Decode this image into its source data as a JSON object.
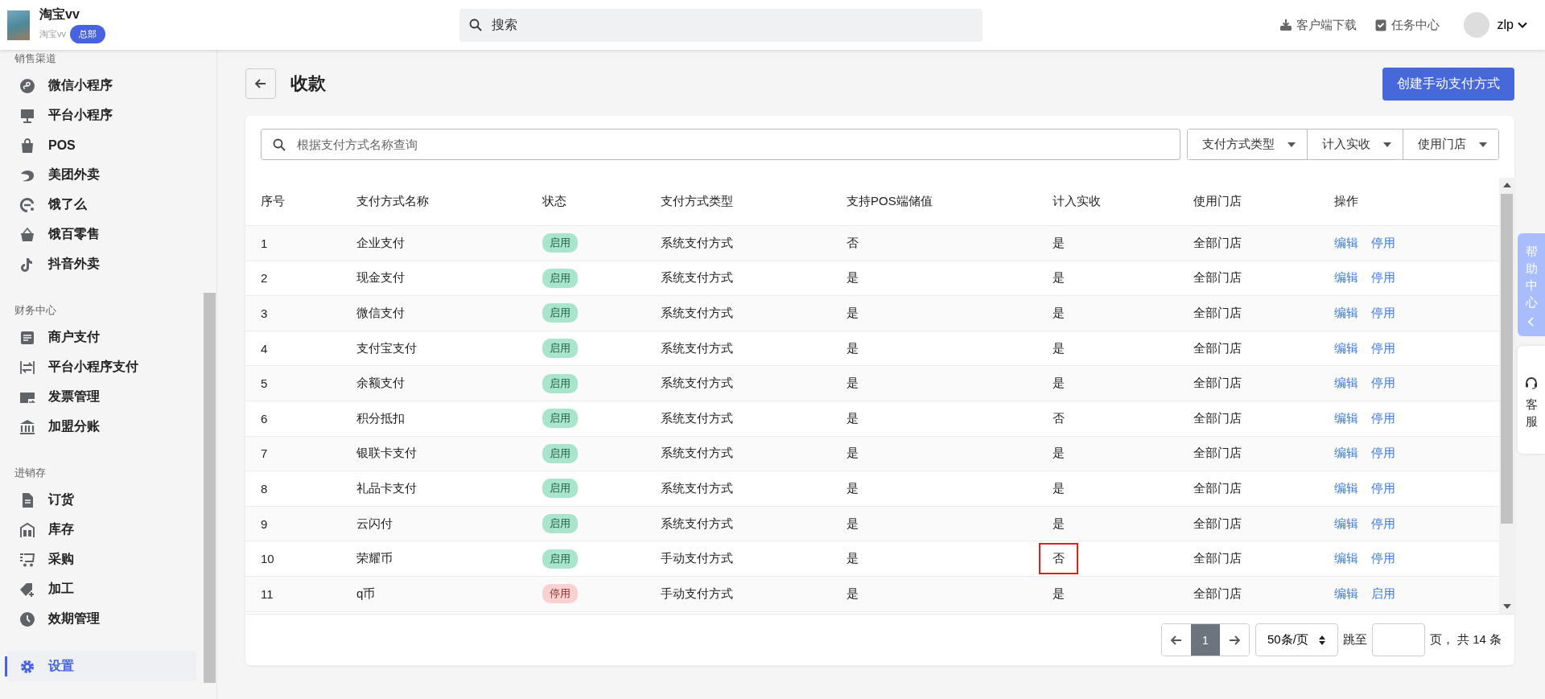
{
  "header": {
    "brand": "淘宝vv",
    "sub": "淘宝vv",
    "badge": "总部",
    "search_placeholder": "搜索",
    "links": [
      {
        "label": "客户端下载"
      },
      {
        "label": "任务中心"
      }
    ],
    "user": "zlp"
  },
  "sidebar": {
    "groups": [
      {
        "label": "销售渠道",
        "items": [
          {
            "label": "微信小程序",
            "selected": false
          },
          {
            "label": "平台小程序",
            "selected": false
          },
          {
            "label": "POS",
            "selected": false
          },
          {
            "label": "美团外卖",
            "selected": false
          },
          {
            "label": "饿了么",
            "selected": false
          },
          {
            "label": "饿百零售",
            "selected": false
          },
          {
            "label": "抖音外卖",
            "selected": false
          }
        ]
      },
      {
        "label": "财务中心",
        "items": [
          {
            "label": "商户支付",
            "selected": false
          },
          {
            "label": "平台小程序支付",
            "selected": false
          },
          {
            "label": "发票管理",
            "selected": false
          },
          {
            "label": "加盟分账",
            "selected": false
          }
        ]
      },
      {
        "label": "进销存",
        "items": [
          {
            "label": "订货",
            "selected": false
          },
          {
            "label": "库存",
            "selected": false
          },
          {
            "label": "采购",
            "selected": false
          },
          {
            "label": "加工",
            "selected": false
          },
          {
            "label": "效期管理",
            "selected": false
          }
        ]
      },
      {
        "items": [
          {
            "label": "设置",
            "selected": true
          }
        ]
      }
    ]
  },
  "page": {
    "title": "收款",
    "create_button": "创建手动支付方式"
  },
  "filters": {
    "search_placeholder": "根据支付方式名称查询",
    "dropdowns": [
      "支付方式类型",
      "计入实收",
      "使用门店"
    ]
  },
  "table": {
    "columns": [
      "序号",
      "支付方式名称",
      "状态",
      "支付方式类型",
      "支持POS端储值",
      "计入实收",
      "使用门店",
      "操作"
    ],
    "rows": [
      {
        "no": "1",
        "name": "企业支付",
        "status": "启用",
        "enabled": true,
        "type": "系统支付方式",
        "pos": "否",
        "counted": "是",
        "counted_marked": false,
        "stores": "全部门店",
        "actions": [
          "编辑",
          "停用"
        ]
      },
      {
        "no": "2",
        "name": "现金支付",
        "status": "启用",
        "enabled": true,
        "type": "系统支付方式",
        "pos": "是",
        "counted": "是",
        "counted_marked": false,
        "stores": "全部门店",
        "actions": [
          "编辑",
          "停用"
        ]
      },
      {
        "no": "3",
        "name": "微信支付",
        "status": "启用",
        "enabled": true,
        "type": "系统支付方式",
        "pos": "是",
        "counted": "是",
        "counted_marked": false,
        "stores": "全部门店",
        "actions": [
          "编辑",
          "停用"
        ]
      },
      {
        "no": "4",
        "name": "支付宝支付",
        "status": "启用",
        "enabled": true,
        "type": "系统支付方式",
        "pos": "是",
        "counted": "是",
        "counted_marked": false,
        "stores": "全部门店",
        "actions": [
          "编辑",
          "停用"
        ]
      },
      {
        "no": "5",
        "name": "余额支付",
        "status": "启用",
        "enabled": true,
        "type": "系统支付方式",
        "pos": "是",
        "counted": "是",
        "counted_marked": false,
        "stores": "全部门店",
        "actions": [
          "编辑",
          "停用"
        ]
      },
      {
        "no": "6",
        "name": "积分抵扣",
        "status": "启用",
        "enabled": true,
        "type": "系统支付方式",
        "pos": "是",
        "counted": "否",
        "counted_marked": false,
        "stores": "全部门店",
        "actions": [
          "编辑",
          "停用"
        ]
      },
      {
        "no": "7",
        "name": "银联卡支付",
        "status": "启用",
        "enabled": true,
        "type": "系统支付方式",
        "pos": "是",
        "counted": "是",
        "counted_marked": false,
        "stores": "全部门店",
        "actions": [
          "编辑",
          "停用"
        ]
      },
      {
        "no": "8",
        "name": "礼品卡支付",
        "status": "启用",
        "enabled": true,
        "type": "系统支付方式",
        "pos": "是",
        "counted": "是",
        "counted_marked": false,
        "stores": "全部门店",
        "actions": [
          "编辑",
          "停用"
        ]
      },
      {
        "no": "9",
        "name": "云闪付",
        "status": "启用",
        "enabled": true,
        "type": "系统支付方式",
        "pos": "是",
        "counted": "是",
        "counted_marked": false,
        "stores": "全部门店",
        "actions": [
          "编辑",
          "停用"
        ]
      },
      {
        "no": "10",
        "name": "荣耀币",
        "status": "启用",
        "enabled": true,
        "type": "手动支付方式",
        "pos": "是",
        "counted": "否",
        "counted_marked": true,
        "stores": "全部门店",
        "actions": [
          "编辑",
          "停用"
        ]
      },
      {
        "no": "11",
        "name": "q币",
        "status": "停用",
        "enabled": false,
        "type": "手动支付方式",
        "pos": "是",
        "counted": "是",
        "counted_marked": false,
        "stores": "全部门店",
        "actions": [
          "编辑",
          "启用"
        ]
      }
    ]
  },
  "pagination": {
    "page": "1",
    "page_size": "50条/页",
    "jump_label": "跳至",
    "total": "页， 共 14 条"
  },
  "help_tab": {
    "label": "帮助中心"
  },
  "service_tab": {
    "label": "客服"
  }
}
